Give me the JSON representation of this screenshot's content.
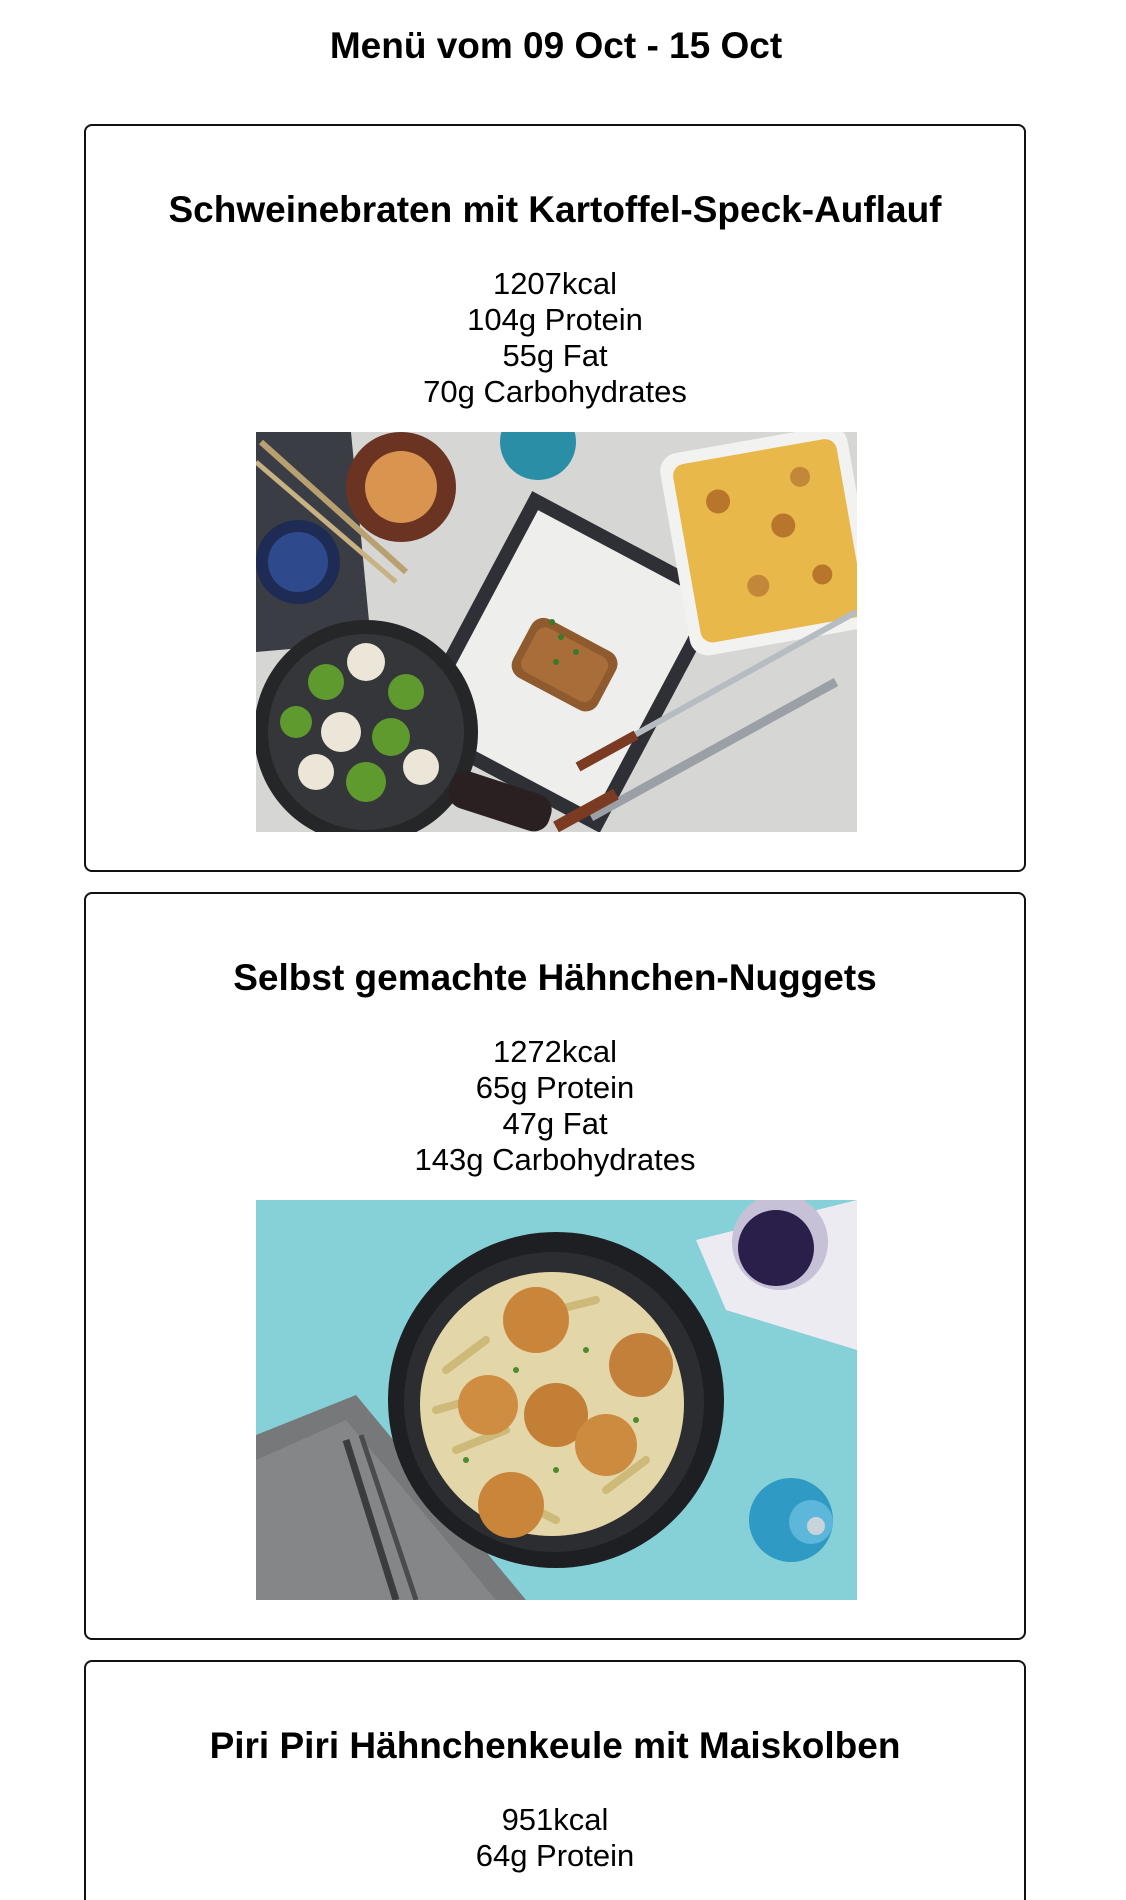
{
  "header": {
    "title": "Menü vom 09 Oct - 15 Oct"
  },
  "recipes": [
    {
      "title": "Schweinebraten mit Kartoffel-Speck-Auflauf",
      "kcal": "1207kcal",
      "protein": "104g Protein",
      "fat": "55g Fat",
      "carbs": "70g Carbohydrates",
      "photo": "roast-pork-potato-gratin-photo"
    },
    {
      "title": "Selbst gemachte Hähnchen-Nuggets",
      "kcal": "1272kcal",
      "protein": "65g Protein",
      "fat": "47g Fat",
      "carbs": "143g Carbohydrates",
      "photo": "chicken-nuggets-pasta-photo"
    },
    {
      "title": "Piri Piri Hähnchenkeule mit Maiskolben",
      "kcal": "951kcal",
      "protein": "64g Protein"
    }
  ]
}
